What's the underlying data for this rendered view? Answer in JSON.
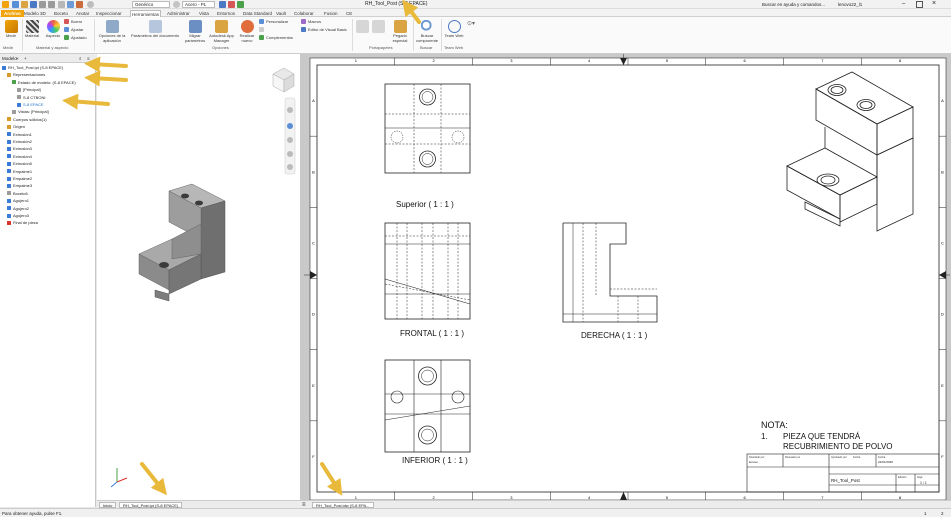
{
  "window": {
    "title": "RH_Tool_Post (S-8 EPACE)",
    "help_search": "Buscar en ayuda y comandos...",
    "user": "lenovo22_l1",
    "qa_style": "Genérico",
    "qa_material": "Acero - PL"
  },
  "tabs": [
    "Archivo",
    "Modelo 3D",
    "Boceto",
    "Anotar",
    "Inspeccionar",
    "Herramientas",
    "Administrar",
    "Vista",
    "Entornos",
    "Data Standard",
    "Vault",
    "Colaborar",
    "Fusion",
    "CE"
  ],
  "active_tab": "Herramientas",
  "ribbon": {
    "medir": "Medir",
    "material": "Material",
    "aspecto": "Aspecto",
    "borrar": "Borrar",
    "ajustar": "Ajustar",
    "ajustado": "Ajustado",
    "opciones_app": "Opciones de la aplicación",
    "parametros": "Parámetros del documento",
    "migrar": "Migrar parámetros",
    "autodesk_app": "Autodesk App Manager",
    "realizar_nuevo": "Realizar nuevo",
    "personalizar": "Personalizar",
    "macros": "Macros",
    "complementos": "Complementos",
    "editor_vb": "Editor de Visual Basic",
    "pegado": "Pegado especial",
    "buscar_comp": "Buscar componente",
    "team_web": "Team Web",
    "groups": {
      "medir": "Medir",
      "material": "Material y aspecto",
      "opciones": "Opciones",
      "portapapeles": "Portapapeles",
      "buscar": "Buscar",
      "team_web": "Team Web"
    }
  },
  "browser": {
    "title": "Modelo",
    "items": [
      {
        "label": "RH_Tool_Post.ipt (S-8 EPACE)",
        "color": "#3a7bd5",
        "indent": 0
      },
      {
        "label": "Representaciones",
        "color": "#d99a2b",
        "indent": 1
      },
      {
        "label": "Estado de modelo: (S-8 EPACE)",
        "color": "#4aa14a",
        "indent": 2
      },
      {
        "label": "[Principal]",
        "color": "#9b9b9b",
        "indent": 3
      },
      {
        "label": "S-8 CTBONI",
        "color": "#9b9b9b",
        "indent": 3
      },
      {
        "label": "S-8 EPACE",
        "color": "#3a7bd5",
        "indent": 3,
        "selected": true
      },
      {
        "label": "Vistas: [Principal]",
        "color": "#9b9b9b",
        "indent": 2
      },
      {
        "label": "Cuerpos sólidos(1)",
        "color": "#d99a2b",
        "indent": 1
      },
      {
        "label": "Origen",
        "color": "#d99a2b",
        "indent": 1
      },
      {
        "label": "Extrusión1",
        "color": "#3a7bd5",
        "indent": 1
      },
      {
        "label": "Extrusión2",
        "color": "#3a7bd5",
        "indent": 1
      },
      {
        "label": "Extrusión3",
        "color": "#3a7bd5",
        "indent": 1
      },
      {
        "label": "Extrusión4",
        "color": "#3a7bd5",
        "indent": 1
      },
      {
        "label": "Extrusión5",
        "color": "#3a7bd5",
        "indent": 1
      },
      {
        "label": "Empalme1",
        "color": "#3a7bd5",
        "indent": 1
      },
      {
        "label": "Empalme2",
        "color": "#3a7bd5",
        "indent": 1
      },
      {
        "label": "Empalme3",
        "color": "#3a7bd5",
        "indent": 1
      },
      {
        "label": "Boceto6",
        "color": "#9b9b9b",
        "indent": 1
      },
      {
        "label": "Agujero1",
        "color": "#3a7bd5",
        "indent": 1
      },
      {
        "label": "Agujero2",
        "color": "#3a7bd5",
        "indent": 1
      },
      {
        "label": "Agujero3",
        "color": "#3a7bd5",
        "indent": 1
      },
      {
        "label": "Final de pieza",
        "color": "#d9342b",
        "indent": 1
      }
    ]
  },
  "doc_tabs": {
    "home": "Inicio",
    "part": "RH_Tool_Post.ipt (S-8 EPACE)",
    "drawing": "RH_Tool_Post.idw (S-8 EPA..."
  },
  "drawing": {
    "col_marks": [
      "1",
      "2",
      "3",
      "4",
      "5",
      "6",
      "7",
      "8"
    ],
    "row_marks": [
      "A",
      "B",
      "C",
      "D",
      "E",
      "F"
    ],
    "view_superior": "Superior ( 1 : 1 )",
    "view_frontal": "FRONTAL ( 1 : 1 )",
    "view_derecha": "DERECHA ( 1 : 1 )",
    "view_inferior": "INFERIOR ( 1 : 1 )",
    "note_title": "NOTA:",
    "note_num": "1.",
    "note_line1": "PIEZA QUE TENDRÁ",
    "note_line2": "RECUBRIMIENTO DE POLVO",
    "tb_design": "Diseñado por",
    "tb_designer": "lenovo",
    "tb_checked": "Revisado por",
    "tb_approved": "Aprobado por",
    "tb_date_label": "Fecha",
    "tb_date": "22/01/2026",
    "tb_fecha2": "Fecha",
    "tb_title": "RH_Tool_Post",
    "tb_edition": "Edición",
    "tb_sheet": "Hoja",
    "tb_sheet_val": "1 / 1"
  },
  "status": {
    "left": "Para obtener ayuda, pulse F1.",
    "right1": "1",
    "right2": "2"
  },
  "colors": {
    "file_tab": "#f0a30a",
    "annotation_arrow": "#e8b93a",
    "selection": "#1f6fd0"
  }
}
